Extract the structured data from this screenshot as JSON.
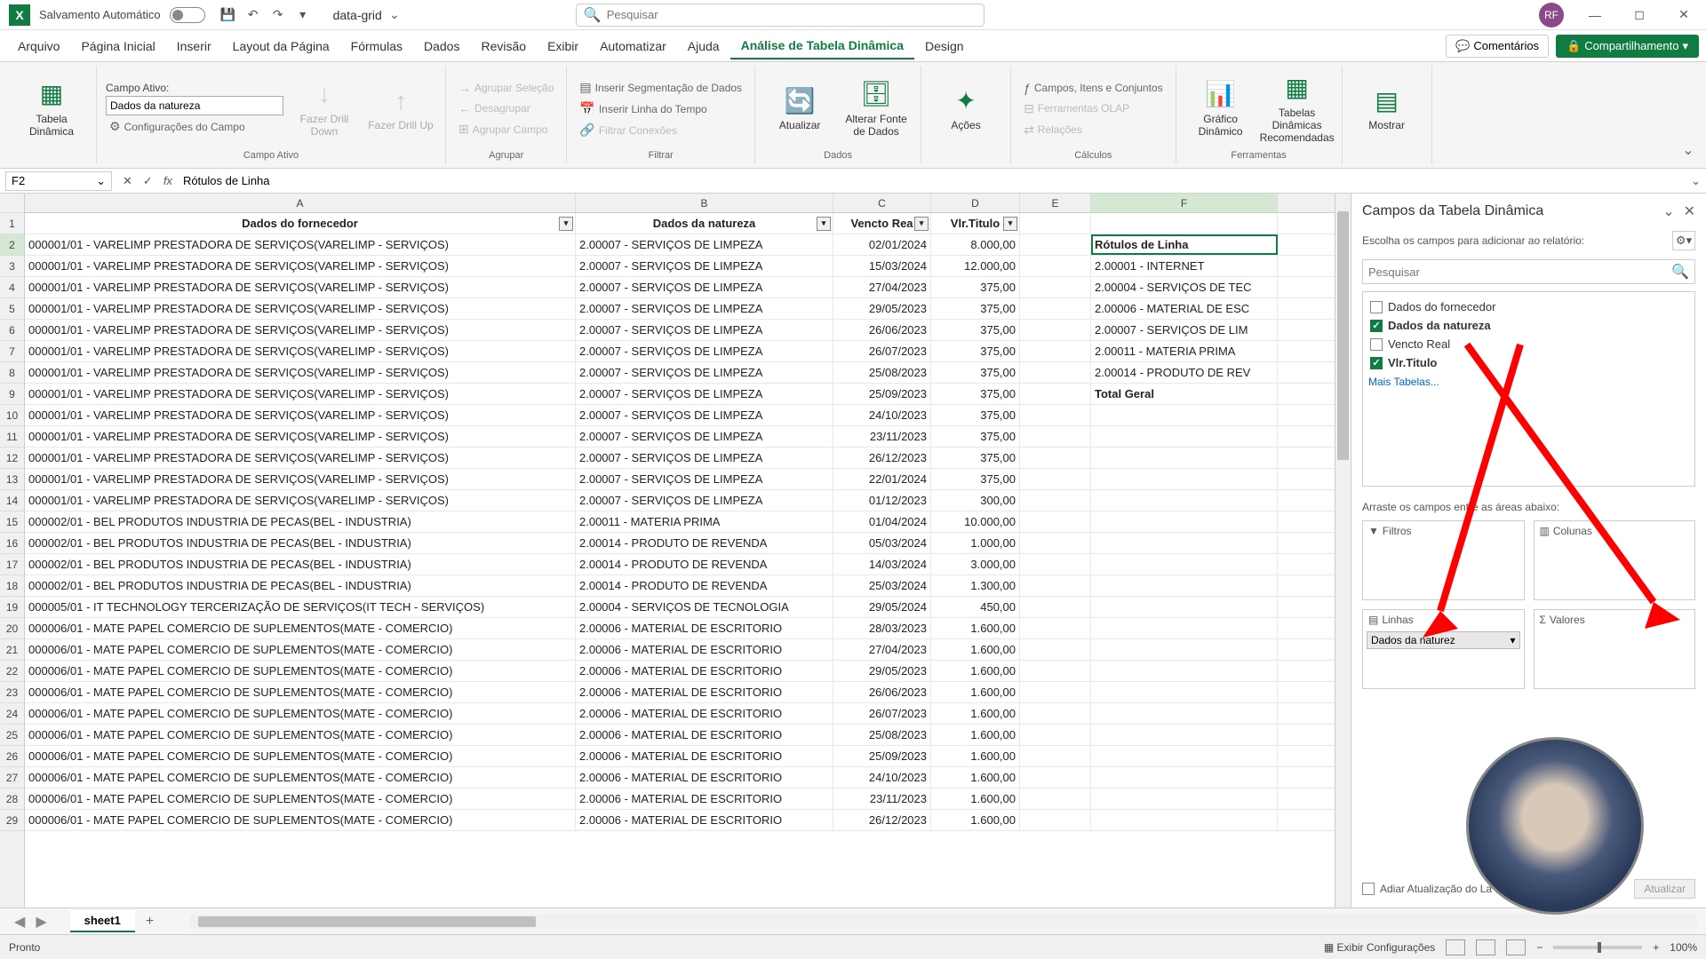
{
  "titlebar": {
    "autosave_label": "Salvamento Automático",
    "filename": "data-grid",
    "search_placeholder": "Pesquisar",
    "user_initials": "RF"
  },
  "tabs": {
    "arquivo": "Arquivo",
    "pagina_inicial": "Página Inicial",
    "inserir": "Inserir",
    "layout": "Layout da Página",
    "formulas": "Fórmulas",
    "dados": "Dados",
    "revisao": "Revisão",
    "exibir": "Exibir",
    "automatizar": "Automatizar",
    "ajuda": "Ajuda",
    "analise": "Análise de Tabela Dinâmica",
    "design": "Design",
    "comentarios": "Comentários",
    "compartilhar": "Compartilhamento"
  },
  "ribbon": {
    "tabela_dinamica": "Tabela Dinâmica",
    "campo_ativo_label": "Campo Ativo:",
    "campo_ativo_value": "Dados da natureza",
    "config_campo": "Configurações do Campo",
    "drill_down": "Fazer Drill Down",
    "drill_up": "Fazer Drill Up",
    "grupo_campo_ativo": "Campo Ativo",
    "agrupar_selecao": "Agrupar Seleção",
    "desagrupar": "Desagrupar",
    "agrupar_campo": "Agrupar Campo",
    "grupo_agrupar": "Agrupar",
    "inserir_segmentacao": "Inserir Segmentação de Dados",
    "inserir_linha_tempo": "Inserir Linha do Tempo",
    "filtrar_conexoes": "Filtrar Conexões",
    "grupo_filtrar": "Filtrar",
    "atualizar": "Atualizar",
    "alterar_fonte": "Alterar Fonte de Dados",
    "grupo_dados": "Dados",
    "acoes": "Ações",
    "campos_itens": "Campos, Itens e Conjuntos",
    "ferramentas_olap": "Ferramentas OLAP",
    "relacoes": "Relações",
    "grupo_calculos": "Cálculos",
    "grafico_dinamico": "Gráfico Dinâmico",
    "tabelas_recomendadas": "Tabelas Dinâmicas Recomendadas",
    "grupo_ferramentas": "Ferramentas",
    "mostrar": "Mostrar"
  },
  "formula_bar": {
    "cell_ref": "F2",
    "fx": "fx",
    "formula": "Rótulos de Linha"
  },
  "columns": {
    "A": "A",
    "B": "B",
    "C": "C",
    "D": "D",
    "E": "E",
    "F": "F"
  },
  "headers": {
    "fornecedor": "Dados do fornecedor",
    "natureza": "Dados da natureza",
    "vencto": "Vencto Rea",
    "vlr_titulo": "Vlr.Titulo"
  },
  "pivot_result": {
    "header": "Rótulos de Linha",
    "r1": "2.00001 - INTERNET",
    "r2": "2.00004 - SERVIÇOS DE TEC",
    "r3": "2.00006 - MATERIAL DE ESC",
    "r4": "2.00007 - SERVIÇOS DE LIM",
    "r5": "2.00011 - MATERIA PRIMA",
    "r6": "2.00014 - PRODUTO DE REV",
    "total": "Total Geral"
  },
  "rows": [
    {
      "n": "2",
      "a": "000001/01 - VARELIMP PRESTADORA DE SERVIÇOS(VARELIMP - SERVIÇOS)",
      "b": "2.00007 - SERVIÇOS DE LIMPEZA",
      "c": "02/01/2024",
      "d": "8.000,00"
    },
    {
      "n": "3",
      "a": "000001/01 - VARELIMP PRESTADORA DE SERVIÇOS(VARELIMP - SERVIÇOS)",
      "b": "2.00007 - SERVIÇOS DE LIMPEZA",
      "c": "15/03/2024",
      "d": "12.000,00"
    },
    {
      "n": "4",
      "a": "000001/01 - VARELIMP PRESTADORA DE SERVIÇOS(VARELIMP - SERVIÇOS)",
      "b": "2.00007 - SERVIÇOS DE LIMPEZA",
      "c": "27/04/2023",
      "d": "375,00"
    },
    {
      "n": "5",
      "a": "000001/01 - VARELIMP PRESTADORA DE SERVIÇOS(VARELIMP - SERVIÇOS)",
      "b": "2.00007 - SERVIÇOS DE LIMPEZA",
      "c": "29/05/2023",
      "d": "375,00"
    },
    {
      "n": "6",
      "a": "000001/01 - VARELIMP PRESTADORA DE SERVIÇOS(VARELIMP - SERVIÇOS)",
      "b": "2.00007 - SERVIÇOS DE LIMPEZA",
      "c": "26/06/2023",
      "d": "375,00"
    },
    {
      "n": "7",
      "a": "000001/01 - VARELIMP PRESTADORA DE SERVIÇOS(VARELIMP - SERVIÇOS)",
      "b": "2.00007 - SERVIÇOS DE LIMPEZA",
      "c": "26/07/2023",
      "d": "375,00"
    },
    {
      "n": "8",
      "a": "000001/01 - VARELIMP PRESTADORA DE SERVIÇOS(VARELIMP - SERVIÇOS)",
      "b": "2.00007 - SERVIÇOS DE LIMPEZA",
      "c": "25/08/2023",
      "d": "375,00"
    },
    {
      "n": "9",
      "a": "000001/01 - VARELIMP PRESTADORA DE SERVIÇOS(VARELIMP - SERVIÇOS)",
      "b": "2.00007 - SERVIÇOS DE LIMPEZA",
      "c": "25/09/2023",
      "d": "375,00"
    },
    {
      "n": "10",
      "a": "000001/01 - VARELIMP PRESTADORA DE SERVIÇOS(VARELIMP - SERVIÇOS)",
      "b": "2.00007 - SERVIÇOS DE LIMPEZA",
      "c": "24/10/2023",
      "d": "375,00"
    },
    {
      "n": "11",
      "a": "000001/01 - VARELIMP PRESTADORA DE SERVIÇOS(VARELIMP - SERVIÇOS)",
      "b": "2.00007 - SERVIÇOS DE LIMPEZA",
      "c": "23/11/2023",
      "d": "375,00"
    },
    {
      "n": "12",
      "a": "000001/01 - VARELIMP PRESTADORA DE SERVIÇOS(VARELIMP - SERVIÇOS)",
      "b": "2.00007 - SERVIÇOS DE LIMPEZA",
      "c": "26/12/2023",
      "d": "375,00"
    },
    {
      "n": "13",
      "a": "000001/01 - VARELIMP PRESTADORA DE SERVIÇOS(VARELIMP - SERVIÇOS)",
      "b": "2.00007 - SERVIÇOS DE LIMPEZA",
      "c": "22/01/2024",
      "d": "375,00"
    },
    {
      "n": "14",
      "a": "000001/01 - VARELIMP PRESTADORA DE SERVIÇOS(VARELIMP - SERVIÇOS)",
      "b": "2.00007 - SERVIÇOS DE LIMPEZA",
      "c": "01/12/2023",
      "d": "300,00"
    },
    {
      "n": "15",
      "a": "000002/01 - BEL PRODUTOS INDUSTRIA DE PECAS(BEL - INDUSTRIA)",
      "b": "2.00011 - MATERIA PRIMA",
      "c": "01/04/2024",
      "d": "10.000,00"
    },
    {
      "n": "16",
      "a": "000002/01 - BEL PRODUTOS INDUSTRIA DE PECAS(BEL - INDUSTRIA)",
      "b": "2.00014 - PRODUTO DE REVENDA",
      "c": "05/03/2024",
      "d": "1.000,00"
    },
    {
      "n": "17",
      "a": "000002/01 - BEL PRODUTOS INDUSTRIA DE PECAS(BEL - INDUSTRIA)",
      "b": "2.00014 - PRODUTO DE REVENDA",
      "c": "14/03/2024",
      "d": "3.000,00"
    },
    {
      "n": "18",
      "a": "000002/01 - BEL PRODUTOS INDUSTRIA DE PECAS(BEL - INDUSTRIA)",
      "b": "2.00014 - PRODUTO DE REVENDA",
      "c": "25/03/2024",
      "d": "1.300,00"
    },
    {
      "n": "19",
      "a": "000005/01 - IT TECHNOLOGY TERCERIZAÇÃO DE SERVIÇOS(IT TECH - SERVIÇOS)",
      "b": "2.00004 - SERVIÇOS DE TECNOLOGIA",
      "c": "29/05/2024",
      "d": "450,00"
    },
    {
      "n": "20",
      "a": "000006/01 - MATE PAPEL COMERCIO DE SUPLEMENTOS(MATE - COMERCIO)",
      "b": "2.00006 - MATERIAL DE ESCRITORIO",
      "c": "28/03/2023",
      "d": "1.600,00"
    },
    {
      "n": "21",
      "a": "000006/01 - MATE PAPEL COMERCIO DE SUPLEMENTOS(MATE - COMERCIO)",
      "b": "2.00006 - MATERIAL DE ESCRITORIO",
      "c": "27/04/2023",
      "d": "1.600,00"
    },
    {
      "n": "22",
      "a": "000006/01 - MATE PAPEL COMERCIO DE SUPLEMENTOS(MATE - COMERCIO)",
      "b": "2.00006 - MATERIAL DE ESCRITORIO",
      "c": "29/05/2023",
      "d": "1.600,00"
    },
    {
      "n": "23",
      "a": "000006/01 - MATE PAPEL COMERCIO DE SUPLEMENTOS(MATE - COMERCIO)",
      "b": "2.00006 - MATERIAL DE ESCRITORIO",
      "c": "26/06/2023",
      "d": "1.600,00"
    },
    {
      "n": "24",
      "a": "000006/01 - MATE PAPEL COMERCIO DE SUPLEMENTOS(MATE - COMERCIO)",
      "b": "2.00006 - MATERIAL DE ESCRITORIO",
      "c": "26/07/2023",
      "d": "1.600,00"
    },
    {
      "n": "25",
      "a": "000006/01 - MATE PAPEL COMERCIO DE SUPLEMENTOS(MATE - COMERCIO)",
      "b": "2.00006 - MATERIAL DE ESCRITORIO",
      "c": "25/08/2023",
      "d": "1.600,00"
    },
    {
      "n": "26",
      "a": "000006/01 - MATE PAPEL COMERCIO DE SUPLEMENTOS(MATE - COMERCIO)",
      "b": "2.00006 - MATERIAL DE ESCRITORIO",
      "c": "25/09/2023",
      "d": "1.600,00"
    },
    {
      "n": "27",
      "a": "000006/01 - MATE PAPEL COMERCIO DE SUPLEMENTOS(MATE - COMERCIO)",
      "b": "2.00006 - MATERIAL DE ESCRITORIO",
      "c": "24/10/2023",
      "d": "1.600,00"
    },
    {
      "n": "28",
      "a": "000006/01 - MATE PAPEL COMERCIO DE SUPLEMENTOS(MATE - COMERCIO)",
      "b": "2.00006 - MATERIAL DE ESCRITORIO",
      "c": "23/11/2023",
      "d": "1.600,00"
    },
    {
      "n": "29",
      "a": "000006/01 - MATE PAPEL COMERCIO DE SUPLEMENTOS(MATE - COMERCIO)",
      "b": "2.00006 - MATERIAL DE ESCRITORIO",
      "c": "26/12/2023",
      "d": "1.600,00"
    }
  ],
  "pivot_pane": {
    "title": "Campos da Tabela Dinâmica",
    "subtitle": "Escolha os campos para adicionar ao relatório:",
    "search_placeholder": "Pesquisar",
    "fields": {
      "fornecedor": "Dados do fornecedor",
      "natureza": "Dados da natureza",
      "vencto": "Vencto Real",
      "vlr_titulo": "Vlr.Titulo"
    },
    "more_tables": "Mais Tabelas...",
    "drag_text": "Arraste os campos entre as áreas abaixo:",
    "filtros": "Filtros",
    "colunas": "Colunas",
    "linhas": "Linhas",
    "valores": "Valores",
    "linha_item": "Dados da naturez",
    "defer": "Adiar Atualização do La",
    "atualizar": "Atualizar"
  },
  "sheets": {
    "sheet1": "sheet1"
  },
  "status": {
    "pronto": "Pronto",
    "exibir_config": "Exibir Configurações",
    "zoom": "100%"
  }
}
